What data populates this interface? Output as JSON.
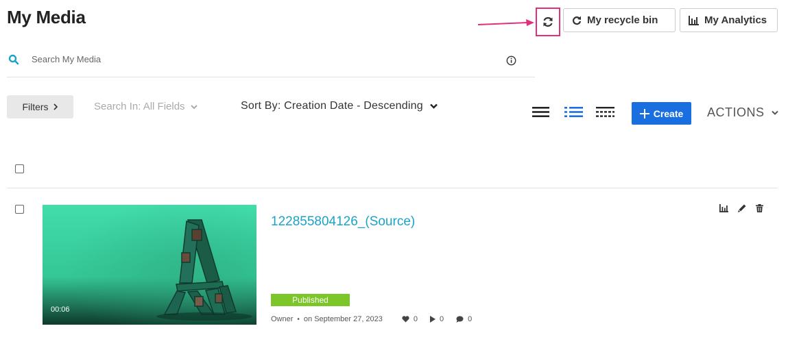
{
  "header": {
    "title": "My Media",
    "recycle_bin_label": "My recycle bin",
    "analytics_label": "My Analytics"
  },
  "search": {
    "placeholder": "Search My Media"
  },
  "toolbar": {
    "filters_label": "Filters",
    "search_in_label": "Search In: All Fields",
    "sort_by_label": "Sort By: Creation Date - Descending",
    "create_label": "Create",
    "actions_label": "ACTIONS"
  },
  "entries": [
    {
      "title": "122855804126_(Source)",
      "duration": "00:06",
      "status": "Published",
      "owner": "Owner",
      "date": "on September 27, 2023",
      "likes": "0",
      "plays": "0",
      "comments": "0"
    }
  ],
  "colors": {
    "accent_blue": "#1a6fe0",
    "title_link": "#1aa3c8",
    "published_green": "#7cc62a",
    "highlight_pink": "#e0307a"
  }
}
